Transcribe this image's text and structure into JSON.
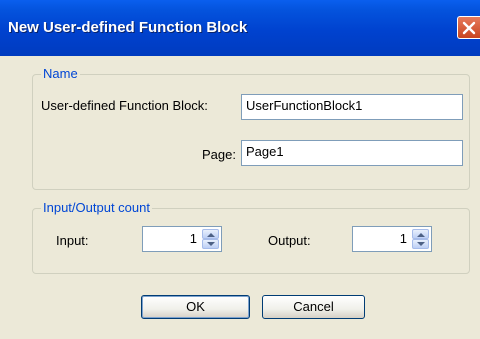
{
  "window": {
    "title": "New User-defined Function Block"
  },
  "name_group": {
    "legend": "Name",
    "function_block_label": "User-defined Function Block:",
    "function_block_value": "UserFunctionBlock1",
    "page_label": "Page:",
    "page_value": "Page1"
  },
  "io_group": {
    "legend": "Input/Output count",
    "input_label": "Input:",
    "input_value": "1",
    "output_label": "Output:",
    "output_value": "1"
  },
  "buttons": {
    "ok_label": "OK",
    "cancel_label": "Cancel"
  },
  "icons": {
    "close": "close-icon",
    "spin_up": "chevron-up-icon",
    "spin_down": "chevron-down-icon"
  },
  "colors": {
    "titlebar": "#0453DD",
    "close_button": "#D6532E",
    "group_legend": "#0046D5",
    "dialog_background": "#ECE9D8"
  }
}
